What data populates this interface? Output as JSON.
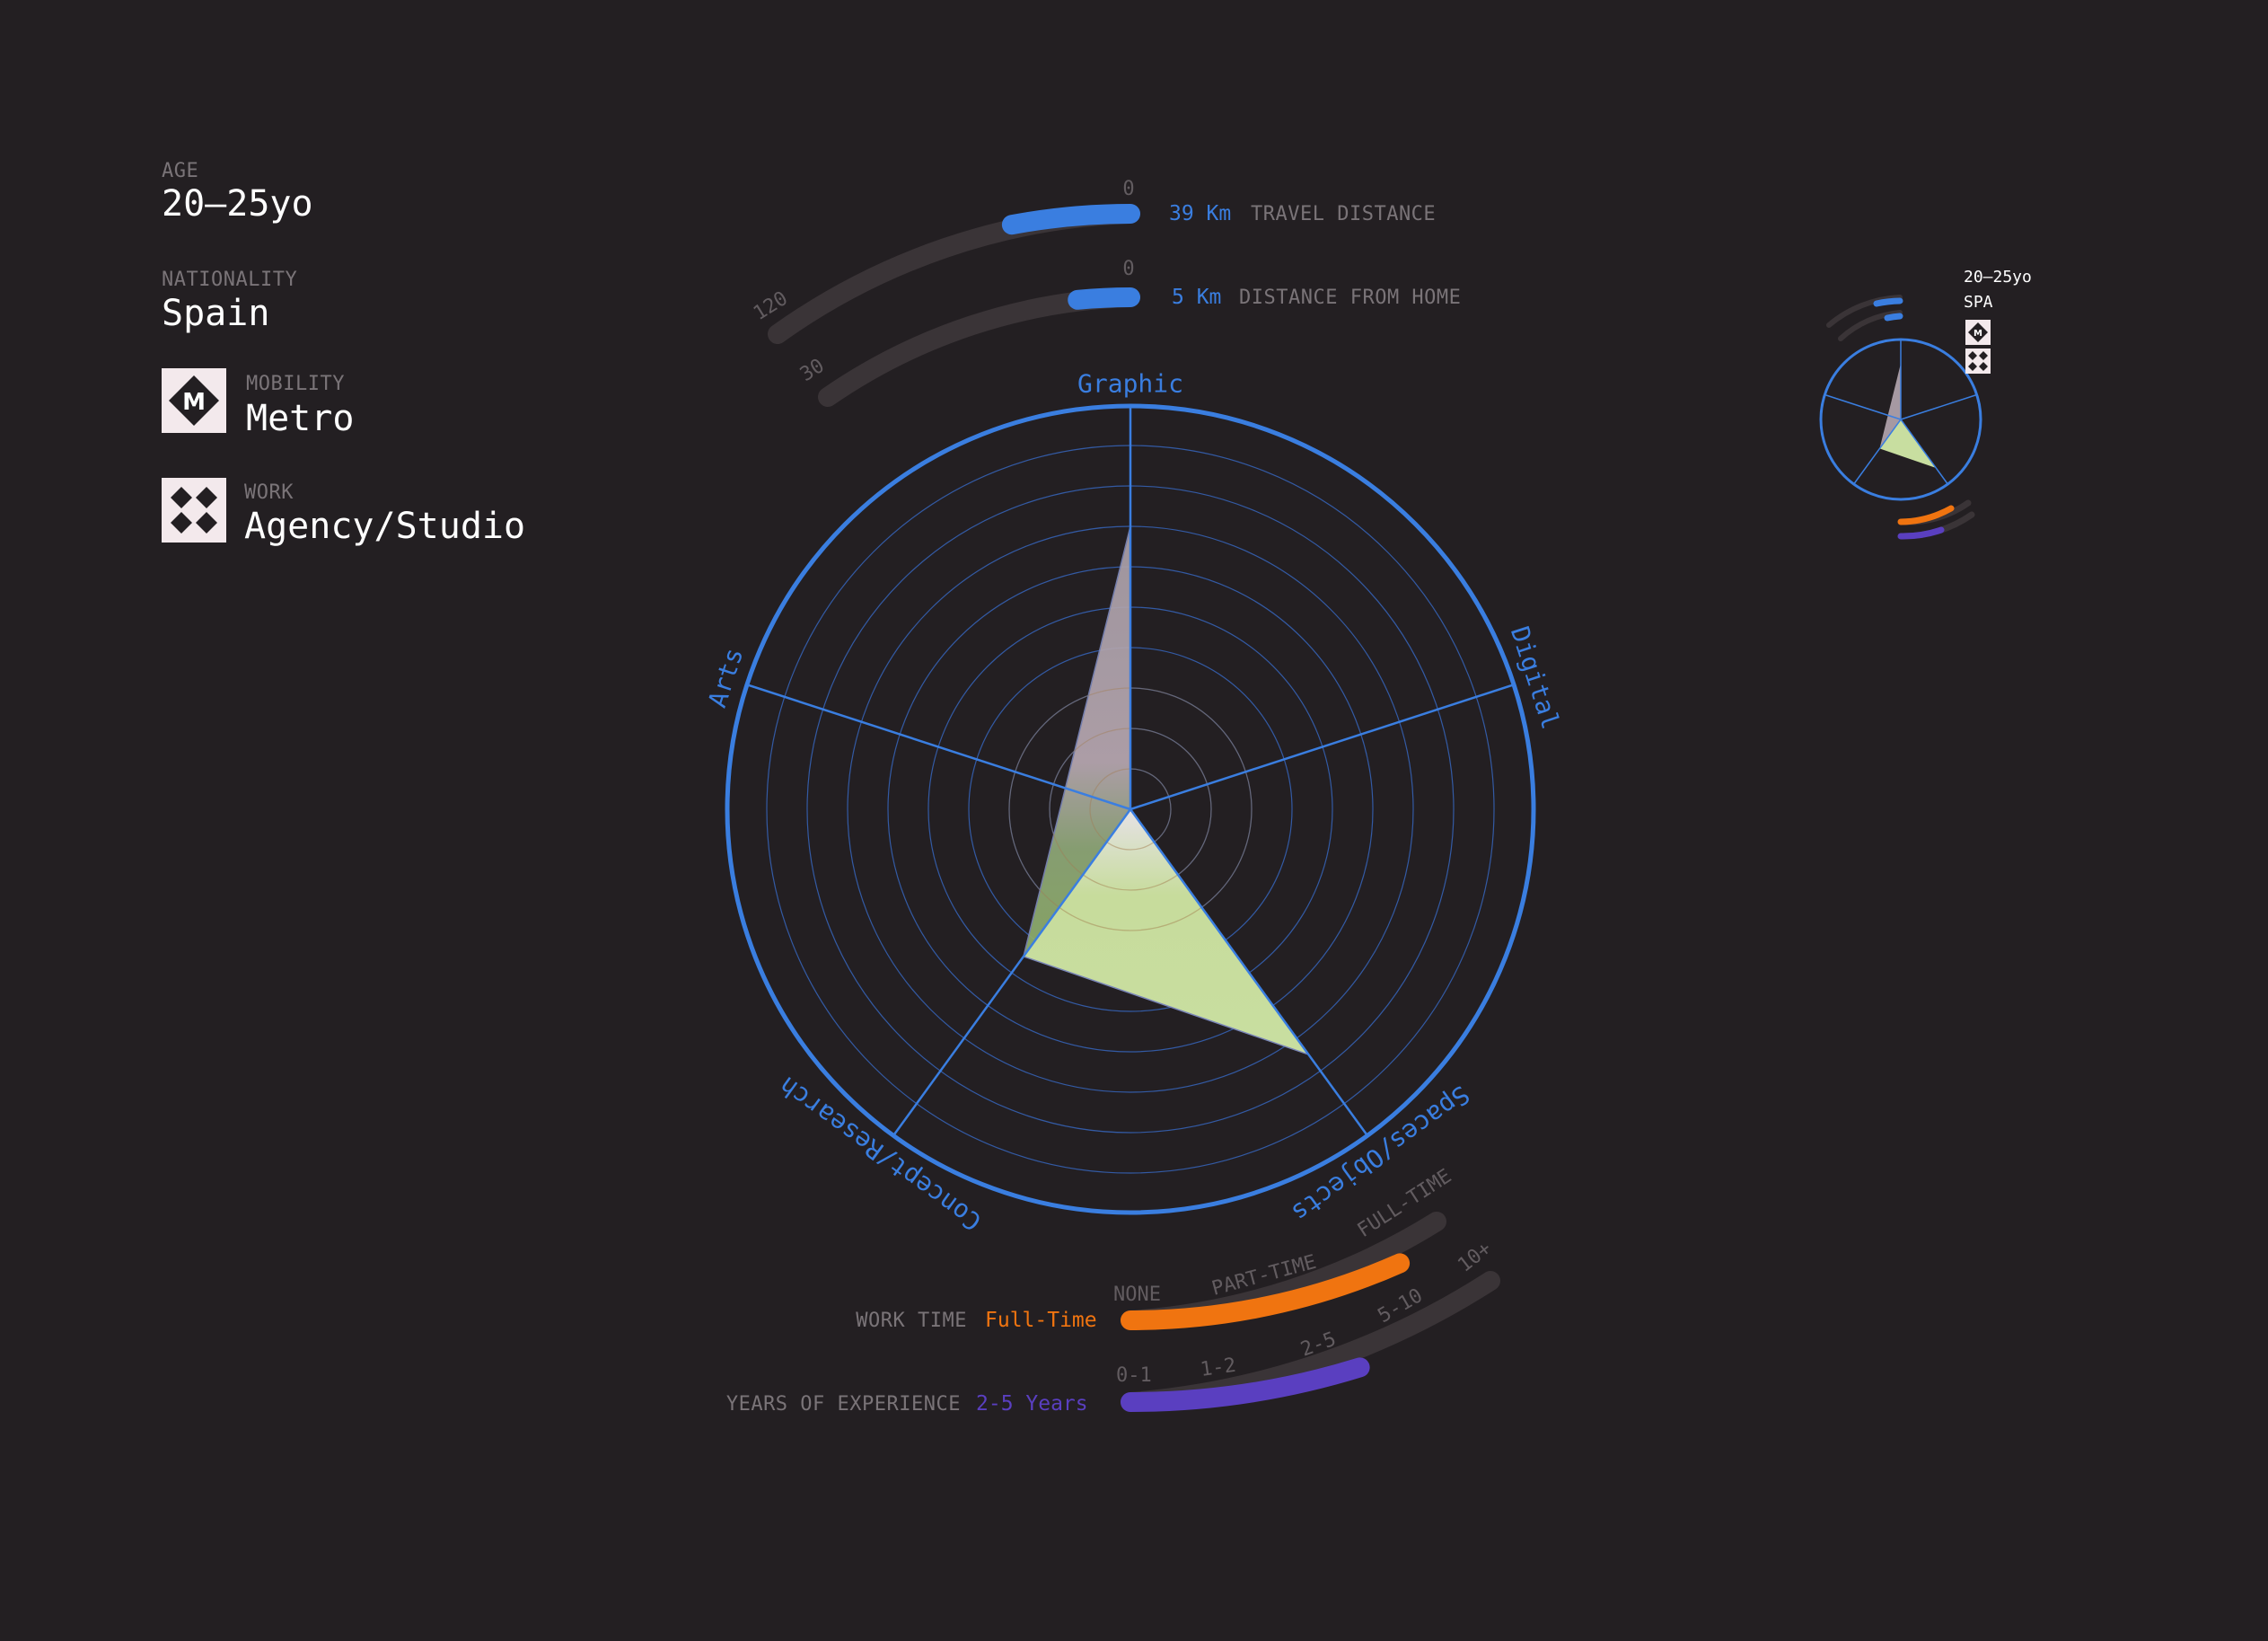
{
  "profile": {
    "age": {
      "label": "AGE",
      "value": "20–25yo"
    },
    "nationality": {
      "label": "NATIONALITY",
      "value": "Spain"
    },
    "mobility": {
      "label": "MOBILITY",
      "value": "Metro",
      "icon": "metro-icon",
      "icon_letter": "M"
    },
    "work": {
      "label": "WORK",
      "value": "Agency/Studio",
      "icon": "agency-studio-icon"
    }
  },
  "distances": {
    "travel": {
      "value": 39,
      "max": 120,
      "unit": "Km",
      "value_text": "39 Km",
      "label": "TRAVEL DISTANCE",
      "min_tick": "0",
      "max_tick": "120"
    },
    "home": {
      "value": 5,
      "max": 30,
      "unit": "Km",
      "value_text": "5 Km",
      "label": "DISTANCE FROM HOME",
      "min_tick": "0",
      "max_tick": "30"
    }
  },
  "work_time": {
    "label": "WORK TIME",
    "value": "Full-Time",
    "level_fraction": 0.87,
    "ticks": [
      "NONE",
      "PART-TIME",
      "FULL-TIME"
    ]
  },
  "experience": {
    "label": "YEARS OF EXPERIENCE",
    "value": "2-5 Years",
    "level_fraction": 0.6,
    "ticks": [
      "0-1",
      "1-2",
      "2-5",
      "5-10",
      "10+"
    ]
  },
  "thumbnail": {
    "age": "20–25yo",
    "nationality": "SPA"
  },
  "colors": {
    "background": "#231f22",
    "accent_blue": "#3a7ee0",
    "work_orange": "#f07410",
    "experience_purple": "#5a3fc0",
    "track": "#3a3437",
    "shape_green": "#c8dea0",
    "shape_mauve": "#b5a6b0"
  },
  "chart_data": {
    "type": "radar",
    "axes": [
      "Graphic",
      "Digital",
      "Spaces/Objects",
      "Concept/Research",
      "Arts"
    ],
    "values": [
      7,
      0,
      7.5,
      4.5,
      0
    ],
    "range": [
      0,
      10
    ],
    "rings": 10
  }
}
